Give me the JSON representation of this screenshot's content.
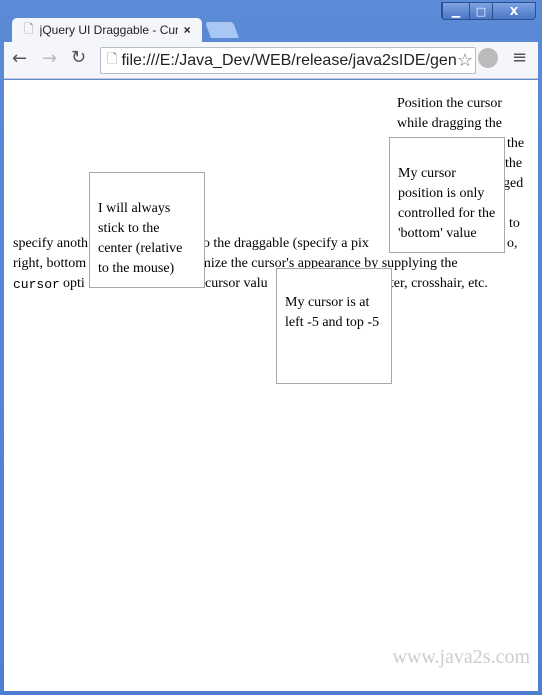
{
  "window": {
    "minimize": "▁",
    "maximize": "□",
    "close": "X"
  },
  "tab": {
    "title": "jQuery UI Draggable - Cur",
    "close": "×"
  },
  "address": {
    "url": "file:///E:/Java_Dev/WEB/release/java2sIDE/gen"
  },
  "page": {
    "right_lines": [
      "Position the cursor",
      "while dragging the"
    ],
    "fragments": [
      "the",
      "the",
      "ged",
      "to",
      "specify anoth",
      "to the draggable (specify a pix",
      "o,",
      "right, bottom",
      "mize the cursor's appearance by supplying the",
      "cursor",
      "opti",
      "cursor valu",
      "inter, crosshair, etc."
    ],
    "box_center": "I will always stick to the center (relative to the mouse)",
    "box_bottom": "My cursor position is only controlled for the 'bottom' value",
    "box_lefttop": "My cursor is at left -5 and top -5",
    "watermark": "www.java2s.com"
  }
}
